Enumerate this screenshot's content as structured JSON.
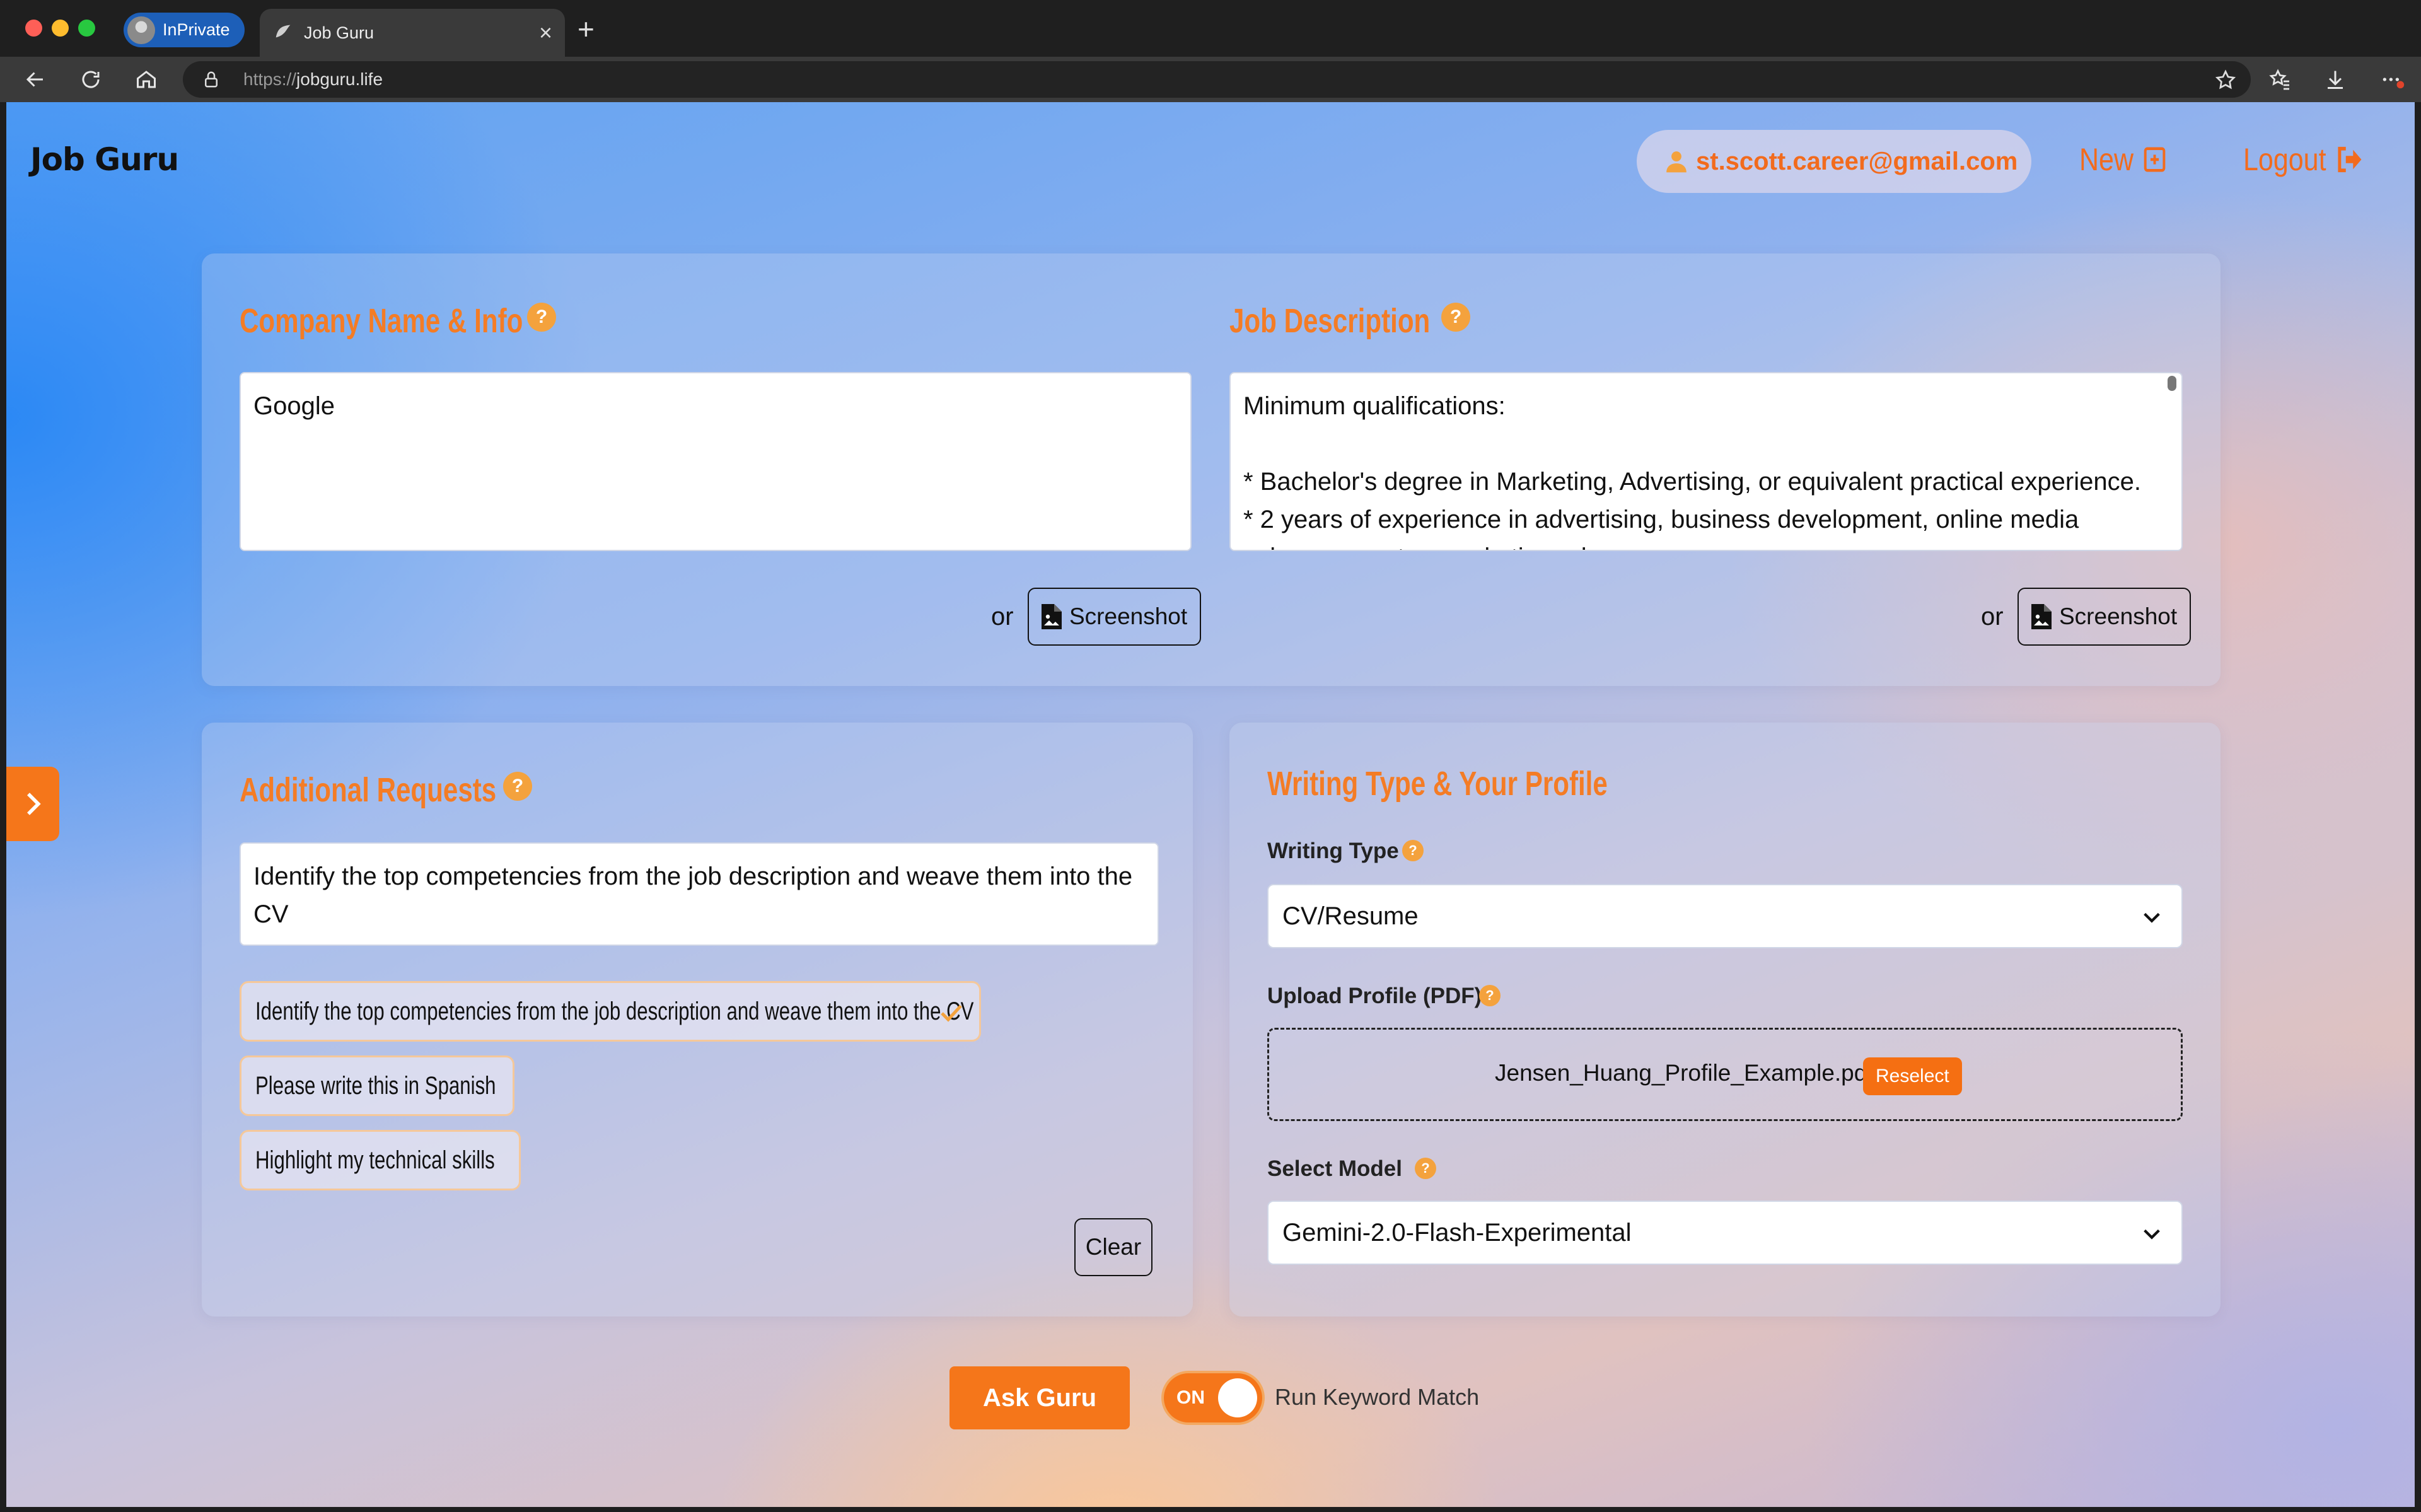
{
  "browser": {
    "profile_label": "InPrivate",
    "tab_title": "Job Guru",
    "url_protocol": "https://",
    "url_host": "jobguru.life"
  },
  "header": {
    "brand": "Job Guru",
    "user_email": "st.scott.career@gmail.com",
    "new_label": "New",
    "logout_label": "Logout"
  },
  "company": {
    "title": "Company Name & Info",
    "value": "Google",
    "or_label": "or",
    "screenshot_label": "Screenshot"
  },
  "job": {
    "title": "Job Description",
    "lines": [
      "Minimum qualifications:",
      "",
      "* Bachelor's degree in Marketing, Advertising, or equivalent practical experience.",
      "* 2 years of experience in advertising, business development, online media",
      "  sales, account or marketing roles."
    ],
    "or_label": "or",
    "screenshot_label": "Screenshot"
  },
  "additional": {
    "title": "Additional Requests",
    "value": "Identify the top competencies from the job description and weave them into the CV",
    "suggestions": [
      {
        "label": "Identify the top competencies from the job description and weave them into the CV",
        "selected": true
      },
      {
        "label": "Please write this in Spanish",
        "selected": false
      },
      {
        "label": "Highlight my technical skills",
        "selected": false
      }
    ],
    "clear_label": "Clear"
  },
  "profile": {
    "title": "Writing Type & Your Profile",
    "writing_type_label": "Writing Type",
    "writing_type_value": "CV/Resume",
    "upload_label": "Upload Profile (PDF)",
    "file_name": "Jensen_Huang_Profile_Example.pdf",
    "reselect_label": "Reselect",
    "model_label": "Select Model",
    "model_value": "Gemini-2.0-Flash-Experimental"
  },
  "actions": {
    "ask_label": "Ask Guru",
    "toggle_state": "ON",
    "toggle_label": "Run Keyword Match"
  },
  "colors": {
    "accent": "#f5761a",
    "title_orange": "#f47c25",
    "help_badge": "#f4a23d"
  }
}
